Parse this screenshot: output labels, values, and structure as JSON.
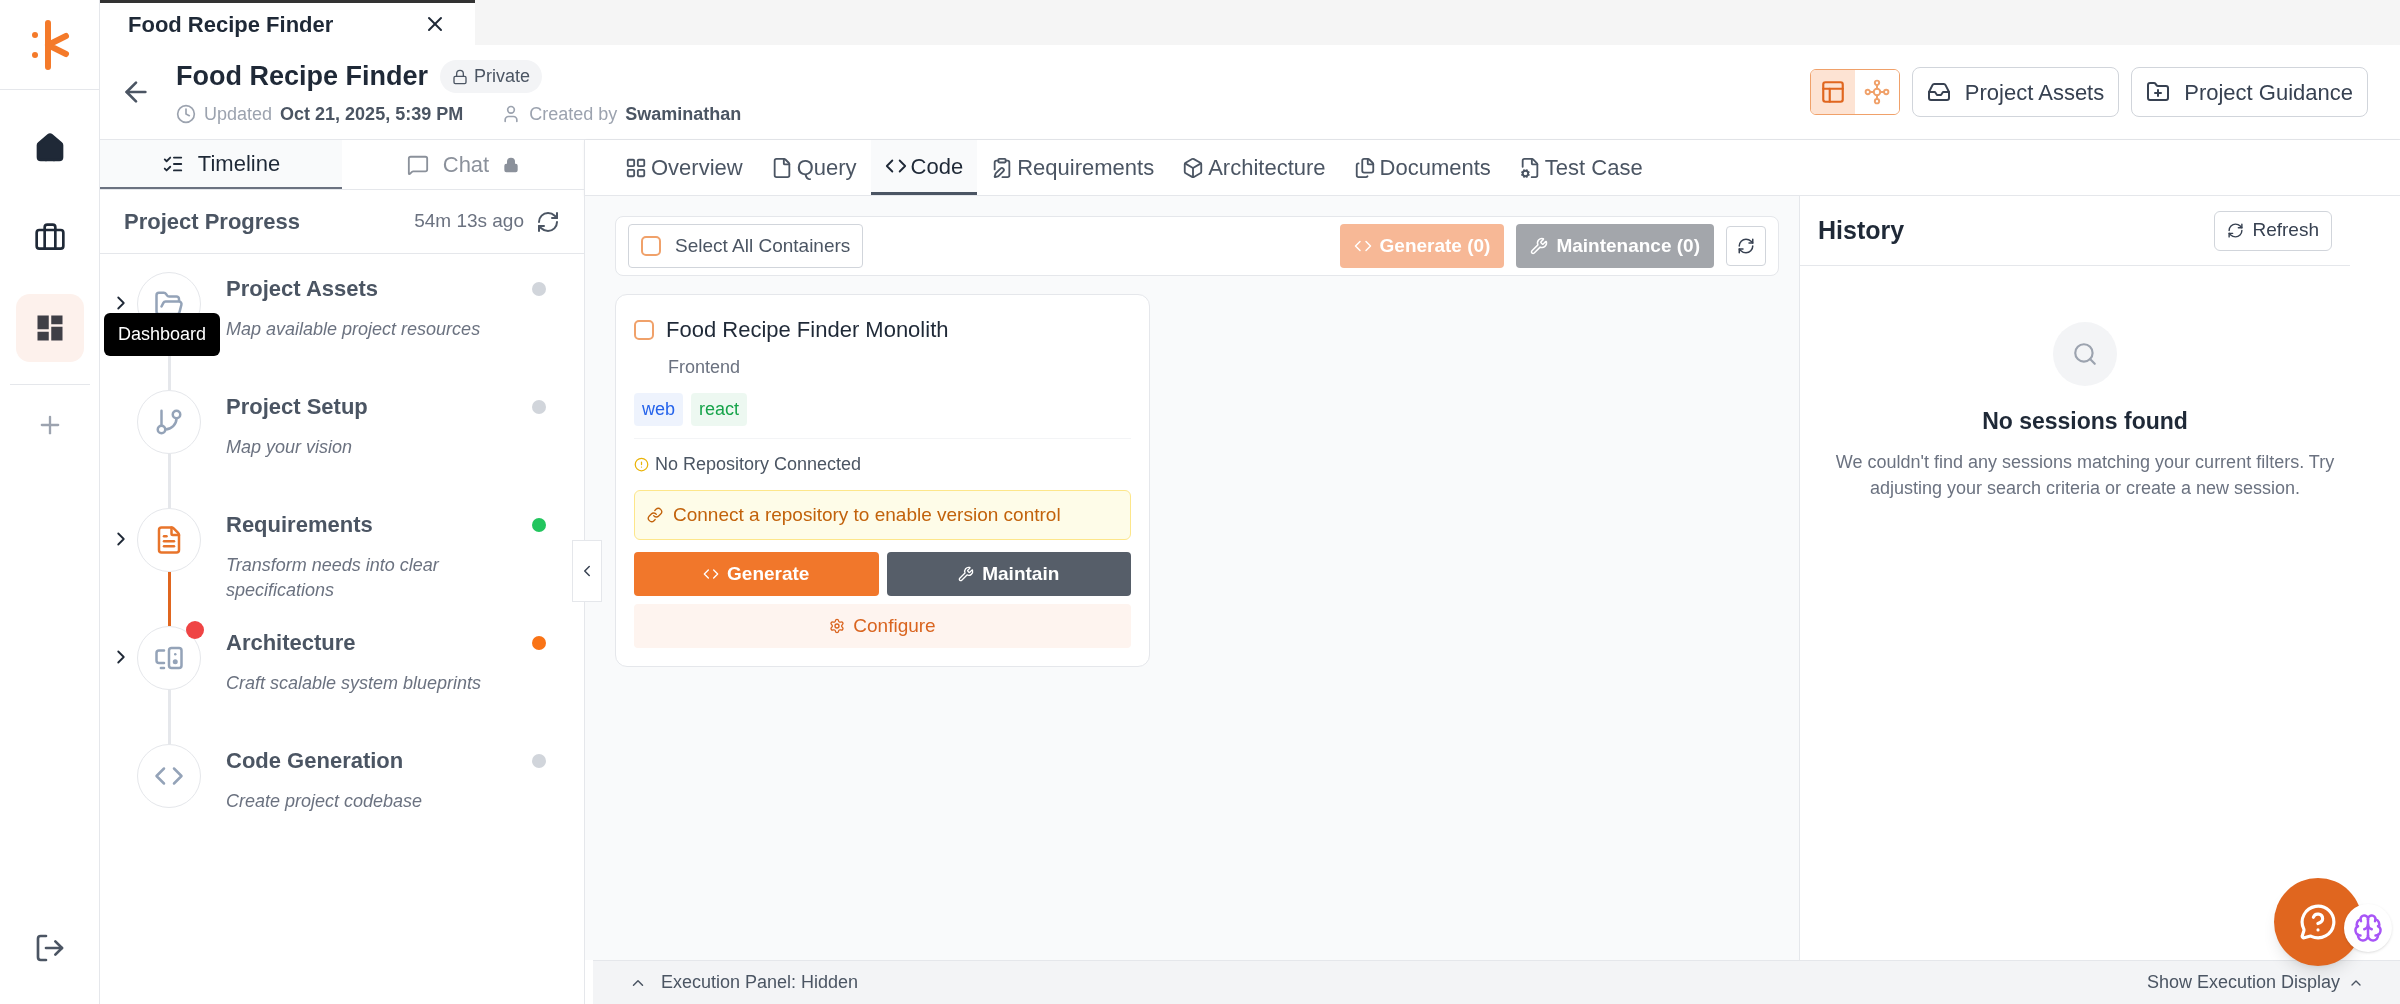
{
  "rail": {
    "items": [
      {
        "kind": "home",
        "selected": false
      },
      {
        "kind": "briefcase",
        "selected": false
      },
      {
        "kind": "dashboard",
        "selected": true
      }
    ],
    "tooltip": "Dashboard"
  },
  "window_tab": {
    "title": "Food Recipe Finder"
  },
  "header": {
    "title": "Food Recipe Finder",
    "visibility": "Private",
    "updated_label": "Updated",
    "updated_value": "Oct 21, 2025, 5:39 PM",
    "created_label": "Created by",
    "creator": "Swaminathan",
    "view_modes": [
      {
        "kind": "layout",
        "selected": true
      },
      {
        "kind": "graph",
        "selected": false
      }
    ],
    "buttons": [
      {
        "kind": "inbox",
        "label": "Project Assets"
      },
      {
        "kind": "folder",
        "label": "Project Guidance"
      }
    ]
  },
  "left_tabs": [
    {
      "label": "Timeline",
      "selected": true,
      "disabled": false
    },
    {
      "label": "Chat",
      "selected": false,
      "disabled": true
    }
  ],
  "progress": {
    "title": "Project Progress",
    "time": "54m 13s ago"
  },
  "timeline": [
    {
      "kind": "assets",
      "title": "Project Assets",
      "description": "Map available project resources",
      "color": "#d1d5db",
      "expandable": true,
      "highlighted": false,
      "alert": false
    },
    {
      "kind": "setup",
      "title": "Project Setup",
      "description": "Map your vision",
      "color": "#d1d5db",
      "expandable": false,
      "highlighted": false,
      "alert": false
    },
    {
      "kind": "requirements",
      "title": "Requirements",
      "description": "Transform needs into clear specifications",
      "color": "#22c55e",
      "expandable": true,
      "highlighted": true,
      "alert": false
    },
    {
      "kind": "architecture",
      "title": "Architecture",
      "description": "Craft scalable system blueprints",
      "color": "#f97316",
      "expandable": true,
      "highlighted": false,
      "alert": true
    },
    {
      "kind": "code",
      "title": "Code Generation",
      "description": "Create project codebase",
      "color": "#d1d5db",
      "expandable": false,
      "highlighted": false,
      "alert": false
    }
  ],
  "main_tabs": [
    {
      "kind": "overview",
      "label": "Overview",
      "selected": false
    },
    {
      "kind": "query",
      "label": "Query",
      "selected": false
    },
    {
      "kind": "code",
      "label": "Code",
      "selected": true
    },
    {
      "kind": "requirements",
      "label": "Requirements",
      "selected": false
    },
    {
      "kind": "architecture",
      "label": "Architecture",
      "selected": false
    },
    {
      "kind": "documents",
      "label": "Documents",
      "selected": false
    },
    {
      "kind": "testcase",
      "label": "Test Case",
      "selected": false
    }
  ],
  "toolbar": {
    "select_all": {
      "label": "Select All Containers",
      "checked": false
    },
    "generate": "Generate (0)",
    "maintenance": "Maintenance (0)"
  },
  "container": {
    "checked": false,
    "title": "Food Recipe Finder Monolith",
    "subtitle": "Frontend",
    "tags": [
      {
        "label": "web",
        "color": "#2563eb"
      },
      {
        "label": "react",
        "color": "#16a34a"
      }
    ],
    "repo_status": "No Repository Connected",
    "notice": "Connect a repository to enable version control",
    "generate": "Generate",
    "maintain": "Maintain",
    "configure": "Configure"
  },
  "history": {
    "title": "History",
    "refresh": "Refresh",
    "empty_title": "No sessions found",
    "empty_message": "We couldn't find any sessions matching your current filters. Try adjusting your search criteria or create a new session."
  },
  "execution_bar": {
    "status": "Execution Panel: Hidden",
    "toggle": "Show Execution Display"
  }
}
